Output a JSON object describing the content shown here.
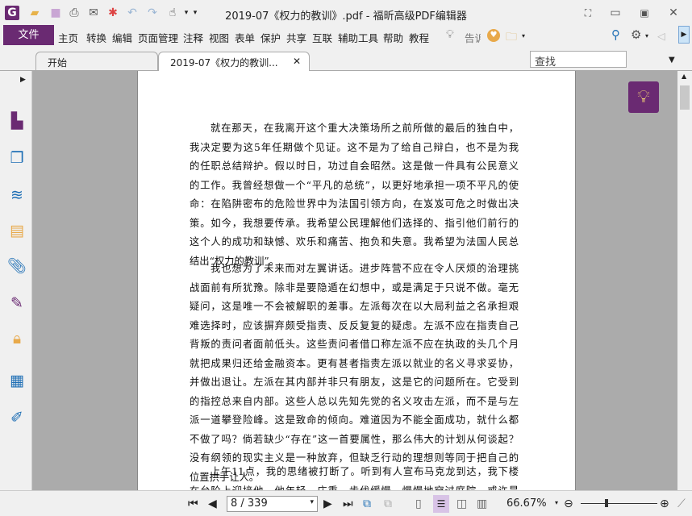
{
  "window": {
    "title": "2019-07《权力的教训》.pdf - 福昕高级PDF编辑器"
  },
  "menu": {
    "file": "文件",
    "items": [
      "主页",
      "转换",
      "编辑",
      "页面管理",
      "注释",
      "视图",
      "表单",
      "保护",
      "共享",
      "互联",
      "辅助工具",
      "帮助",
      "教程"
    ],
    "tell": "告诉",
    "search_placeholder": "查找"
  },
  "tabs": [
    {
      "label": "开始"
    },
    {
      "label": "2019-07《权力的教训..."
    }
  ],
  "document": {
    "paragraphs": [
      [
        "就在那天，在我离开这个重大决策场所之前所做的最后的独白中，",
        "我决定要为这5年任期做个见证。这不是为了给自己辩白，也不是为我",
        "的任职总结辩护。假以时日，功过自会昭然。这是做一件具有公民意义",
        "的工作。我曾经想做一个“平凡的总统”，以更好地承担一项不平凡的使",
        "命：在陷阱密布的危险世界中为法国引领方向，在岌岌可危之时做出决",
        "策。如今，我想要传承。我希望公民理解他们选择的、指引他们前行的",
        "这个人的成功和缺憾、欢乐和痛苦、抱负和失意。我希望为法国人民总",
        "结出“权力的教训”。"
      ],
      [
        "我也想为了未来而对左翼讲话。进步阵营不应在令人厌烦的治理挑",
        "战面前有所犹豫。除非是要隐遁在幻想中，或是满足于只说不做。毫无",
        "疑问，这是唯一不会被解职的差事。左派每次在以大局利益之名承担艰",
        "难选择时，应该摒弃颇受指责、反反复复的疑虑。左派不应在指责自己",
        "背叛的责问者面前低头。这些责问者借口称左派不应在执政的头几个月",
        "就把成果归还给金融资本。更有甚者指责左派以就业的名义寻求妥协，",
        "并做出退让。左派在其内部并非只有朋友，这是它的问题所在。它受到",
        "的指控总来自内部。这些人总以先知先觉的名义攻击左派，而不是与左",
        "派一道攀登险峰。这是致命的倾向。难道因为不能全面成功，就什么都",
        "不做了吗？倘若缺少“存在”这一首要属性，那么伟大的计划从何谈起？",
        "没有纲领的现实主义是一种放弃，但缺乏行动的理想则等同于把自己的",
        "位置拱手让人。"
      ],
      [
        "上午11点，我的思绪被打断了。听到有人宣布马克龙到达，我下楼",
        "在台阶上迎接他。他年轻、庄重，步伐缓慢，慢慢地穿过庭院，或许是"
      ]
    ]
  },
  "status": {
    "page": "8 / 339",
    "zoom": "66.67%"
  },
  "colors": {
    "accent": "#6a2a72",
    "canvas": "#ababab"
  }
}
